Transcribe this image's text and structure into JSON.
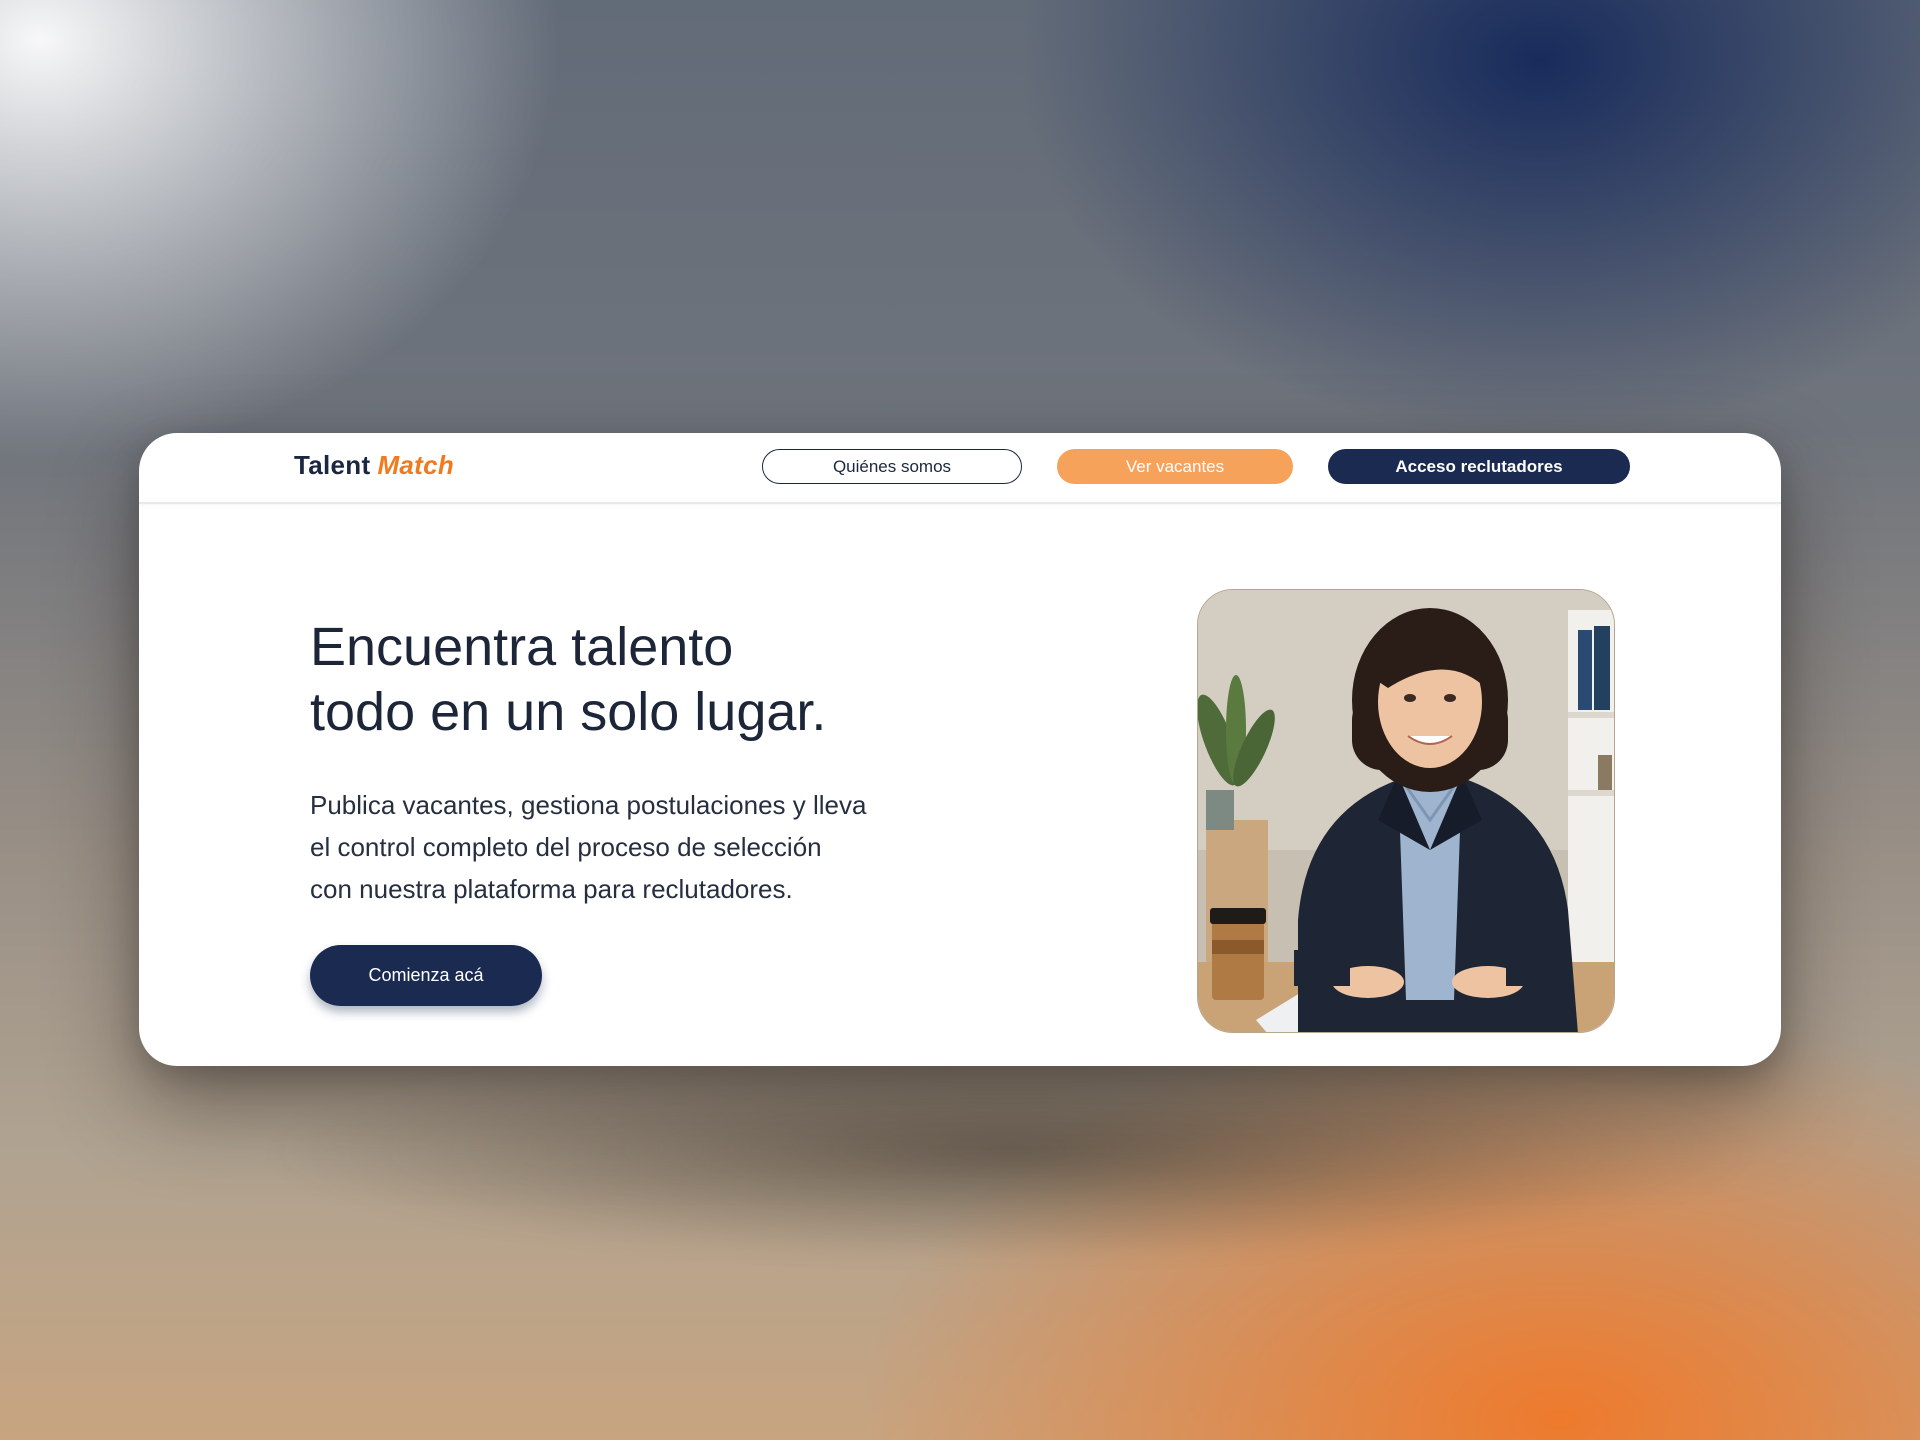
{
  "brand": {
    "word1": "Talent",
    "word2": "Match"
  },
  "nav": {
    "about_label": "Quiénes somos",
    "jobs_label": "Ver vacantes",
    "recruiters_label": "Acceso reclutadores"
  },
  "hero": {
    "title_line1": "Encuentra talento",
    "title_line2": "todo en un solo lugar.",
    "text_line1": "Publica vacantes, gestiona postulaciones y lleva",
    "text_line2": "el control completo del proceso de selección",
    "text_line3": "con nuestra plataforma para reclutadores.",
    "cta_label": "Comienza acá"
  },
  "colors": {
    "navy": "#1b2a50",
    "orange": "#f07a1e",
    "orange_light": "#f7a25a"
  },
  "icons": {
    "photo": "recruiter-photo"
  }
}
